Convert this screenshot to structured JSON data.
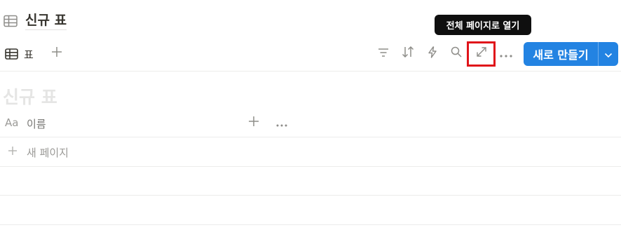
{
  "database": {
    "icon": "table-icon",
    "title": "신규 표"
  },
  "tooltip": {
    "text": "전체 페이지로 열기"
  },
  "view_tab": {
    "icon": "table-icon",
    "label": "표",
    "add_icon": "plus-icon"
  },
  "toolbar": {
    "icons": [
      "filter-icon",
      "sort-icon",
      "lightning-icon",
      "search-icon",
      "expand-icon",
      "more-icon"
    ],
    "highlighted": "expand-icon",
    "highlight_color": "#e0141a",
    "new_button": {
      "label": "새로 만들기",
      "color": "#2383e2",
      "caret_icon": "chevron-down-icon"
    }
  },
  "table": {
    "ghost_title": "신규 표",
    "columns": [
      {
        "type_icon": "Aa",
        "name": "이름"
      }
    ],
    "add_column_icon": "plus-icon",
    "column_menu_icon": "more-icon",
    "new_page_label": "새 페이지"
  }
}
